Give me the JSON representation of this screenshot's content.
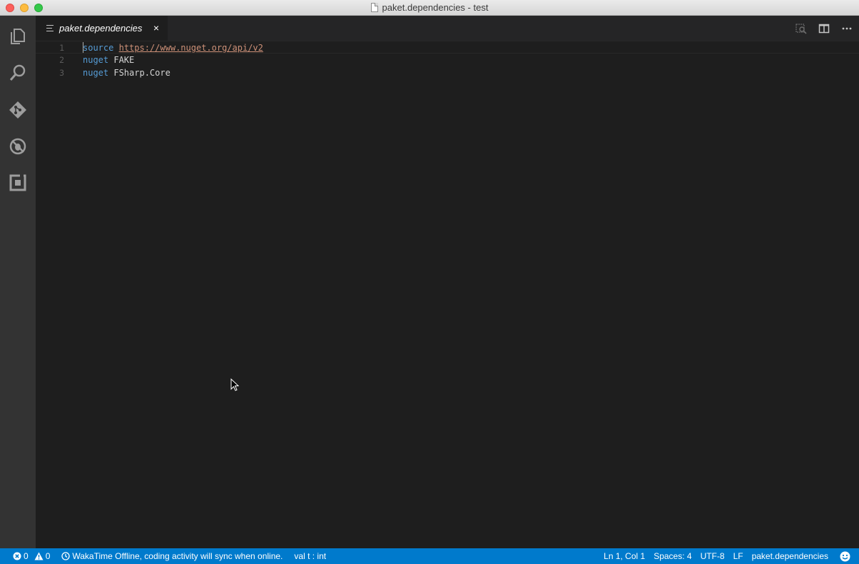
{
  "window": {
    "title": "paket.dependencies - test"
  },
  "activity_bar": {
    "items": [
      {
        "icon": "files-icon"
      },
      {
        "icon": "search-icon"
      },
      {
        "icon": "git-icon"
      },
      {
        "icon": "debug-icon"
      },
      {
        "icon": "extensions-icon"
      }
    ]
  },
  "tabs": [
    {
      "label": "paket.dependencies",
      "close": "×"
    }
  ],
  "editor": {
    "lines": [
      {
        "number": "1",
        "keyword": "source",
        "text": "https://www.nuget.org/api/v2"
      },
      {
        "number": "2",
        "keyword": "nuget",
        "text": "FAKE"
      },
      {
        "number": "3",
        "keyword": "nuget",
        "text": "FSharp.Core"
      }
    ]
  },
  "status_bar": {
    "errors": "0",
    "warnings": "0",
    "wakatime": "WakaTime Offline, coding activity will sync when online.",
    "type_info": "val t : int",
    "position": "Ln 1, Col 1",
    "indent": "Spaces: 4",
    "encoding": "UTF-8",
    "eol": "LF",
    "language": "paket.dependencies"
  },
  "colors": {
    "status_bar": "#007acc",
    "keyword": "#569cd6",
    "string": "#ce9178",
    "editor_bg": "#1e1e1e"
  }
}
